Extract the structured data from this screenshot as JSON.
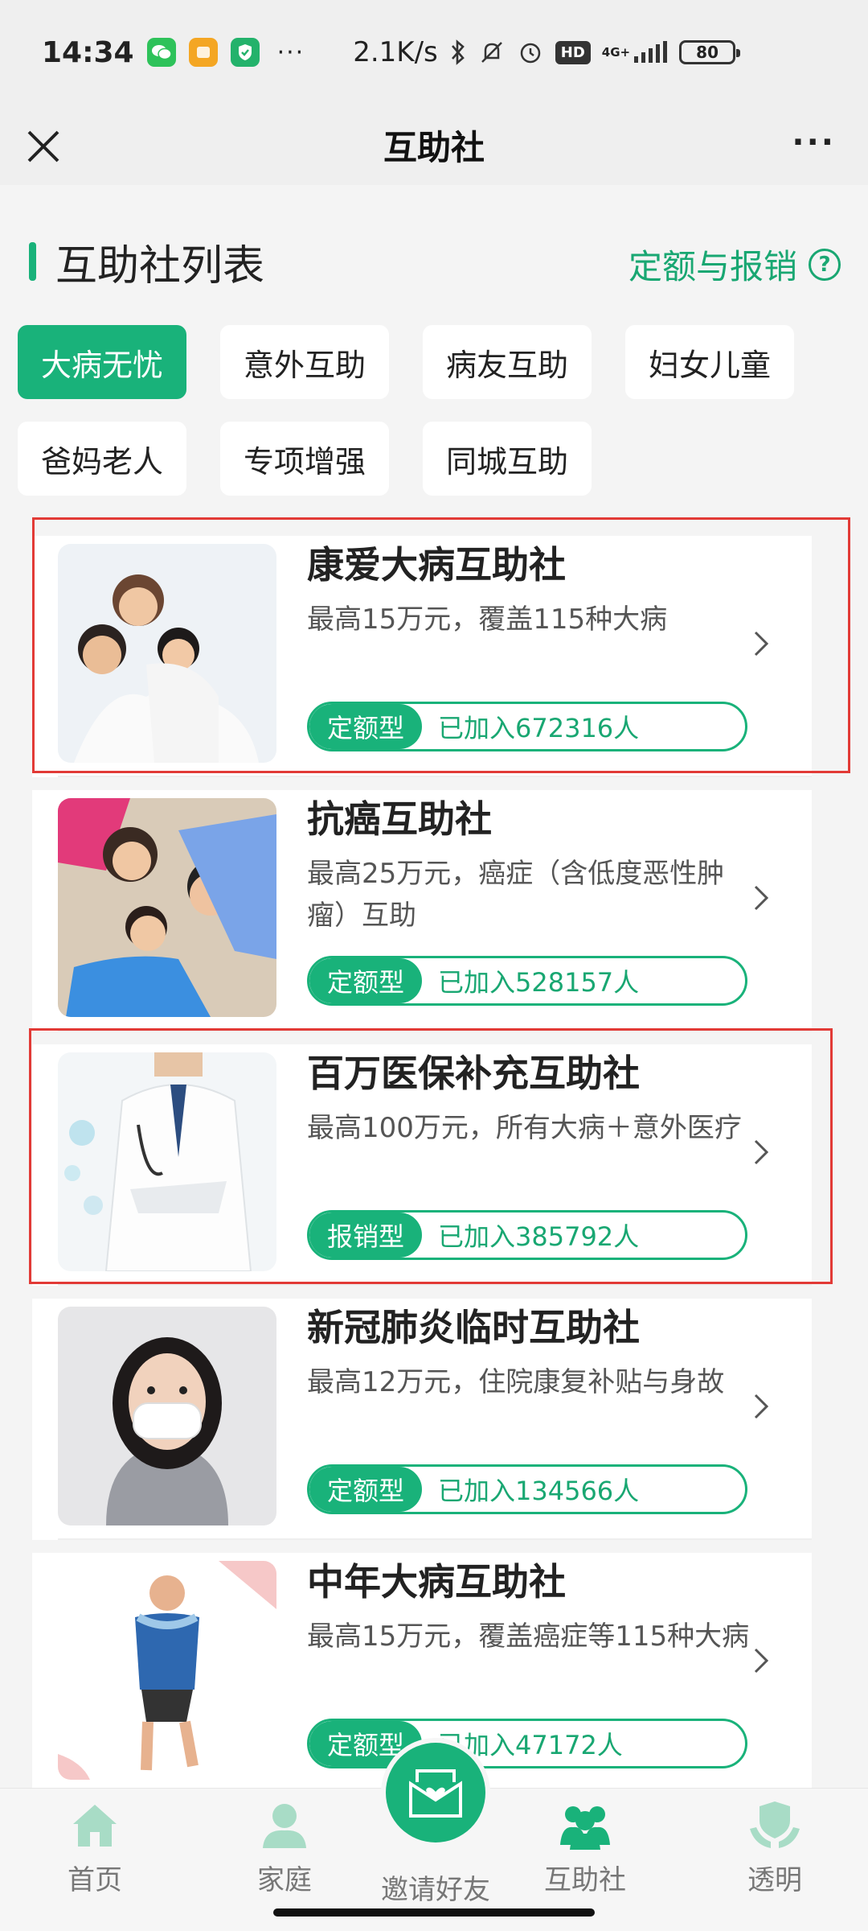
{
  "statusbar": {
    "time": "14:34",
    "dots": "···",
    "speed": "2.1K/s",
    "network": "4G+",
    "hd": "HD",
    "battery": "80"
  },
  "header": {
    "title": "互助社",
    "more": "···"
  },
  "section": {
    "title": "互助社列表",
    "quota_link": "定额与报销",
    "help_icon": "?"
  },
  "categories": [
    "大病无忧",
    "意外互助",
    "病友互助",
    "妇女儿童",
    "爸妈老人",
    "专项增强",
    "同城互助"
  ],
  "active_category": "大病无忧",
  "cards": [
    {
      "name": "康爱大病互助社",
      "desc": "最高15万元，覆盖115种大病",
      "type": "定额型",
      "joined": "已加入672316人"
    },
    {
      "name": "抗癌互助社",
      "desc": "最高25万元，癌症（含低度恶性肿瘤）互助",
      "type": "定额型",
      "joined": "已加入528157人"
    },
    {
      "name": "百万医保补充互助社",
      "desc": "最高100万元，所有大病＋意外医疗",
      "type": "报销型",
      "joined": "已加入385792人"
    },
    {
      "name": "新冠肺炎临时互助社",
      "desc": "最高12万元，住院康复补贴与身故",
      "type": "定额型",
      "joined": "已加入134566人"
    },
    {
      "name": "中年大病互助社",
      "desc": "最高15万元，覆盖癌症等115种大病",
      "type": "定额型",
      "joined": "已加入47172人"
    }
  ],
  "nav": {
    "home": "首页",
    "family": "家庭",
    "invite": "邀请好友",
    "mutual": "互助社",
    "transparent": "透明"
  },
  "colors": {
    "accent": "#19b27a",
    "highlight_border": "#e23a36"
  }
}
